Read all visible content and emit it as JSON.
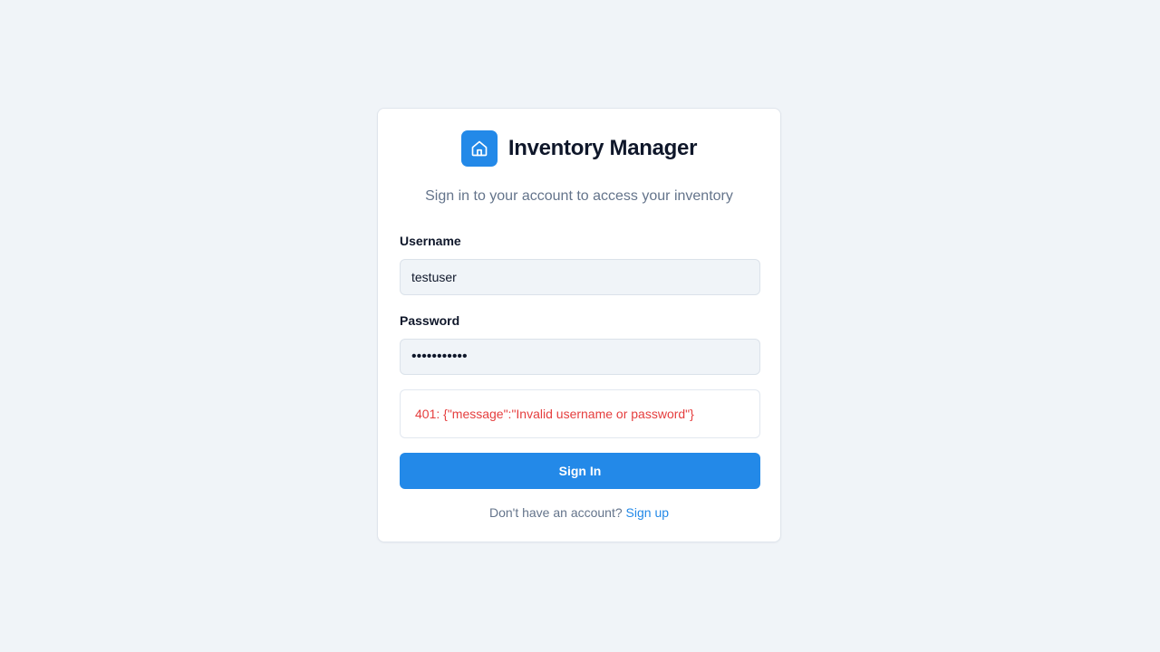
{
  "app": {
    "title": "Inventory Manager",
    "logo_icon": "home-icon",
    "subtitle": "Sign in to your account to access your inventory"
  },
  "form": {
    "username": {
      "label": "Username",
      "value": "testuser"
    },
    "password": {
      "label": "Password",
      "value": "•••••••••••"
    },
    "error": {
      "message": "401: {\"message\":\"Invalid username or password\"}"
    },
    "submit_label": "Sign In"
  },
  "footer": {
    "prompt": "Don't have an account?",
    "signup_label": "Sign up"
  },
  "colors": {
    "accent": "#2389e8",
    "background": "#f0f4f8",
    "error": "#e53e3e",
    "muted_text": "#64748b",
    "heading_text": "#0f172a"
  }
}
